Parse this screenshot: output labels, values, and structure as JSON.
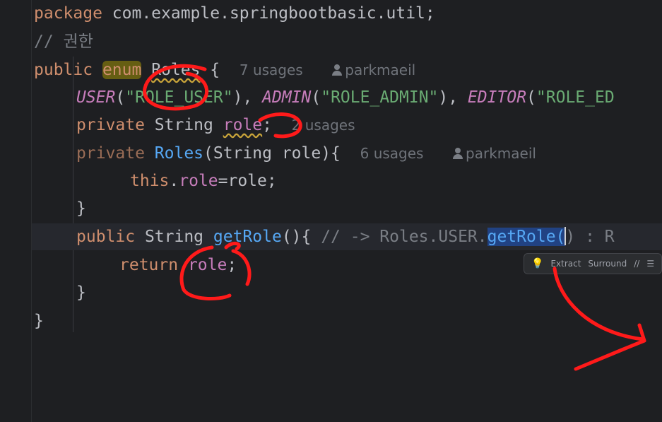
{
  "editor": {
    "lines": {
      "package": {
        "keyword": "package",
        "rest": " com.example.springbootbasic.util;"
      },
      "comment": {
        "text": "// 권한"
      },
      "enum_decl": {
        "public": "public",
        "enum": "enum",
        "name": "Roles",
        "brace": " {",
        "usages": "7 usages",
        "author": "parkmaeil"
      },
      "constants": {
        "c1": "USER",
        "s1": "\"ROLE_USER\"",
        "c2": "ADMIN",
        "s2": "\"ROLE_ADMIN\"",
        "c3": "EDITOR",
        "s3": "\"ROLE_ED"
      },
      "field": {
        "private": "private",
        "type": " String ",
        "name": "role",
        "semi": ";",
        "usages": "2 usages"
      },
      "ctor": {
        "private": "private",
        "name": "Roles",
        "params": "(String role){",
        "usages": "6 usages",
        "author": "parkmaeil"
      },
      "ctor_body": {
        "this": "this",
        "dot": ".",
        "field": "role",
        "rest": "=role;"
      },
      "close_brace": "}",
      "getter": {
        "public": "public",
        "type": " String ",
        "name": "getRole",
        "open": "(){ ",
        "comment_pre": "// -> Roles.USER.",
        "comment_sel": "getRole(",
        "comment_post": ") : R"
      },
      "return": {
        "keyword": "return",
        "field": "role",
        "semi": ";"
      },
      "class_close": "}"
    },
    "popup": {
      "icon": "lightbulb-icon",
      "extract": "Extract",
      "surround": "Surround",
      "comment_glyph": "//",
      "format_glyph": "☰",
      "more_glyph": "⋮"
    },
    "colors": {
      "background": "#1e1f22",
      "keyword": "#cf8e6d",
      "string": "#6aab73",
      "field": "#c77dbb",
      "method": "#56a8f5",
      "annotation_pen": "#ff1a1a"
    }
  }
}
